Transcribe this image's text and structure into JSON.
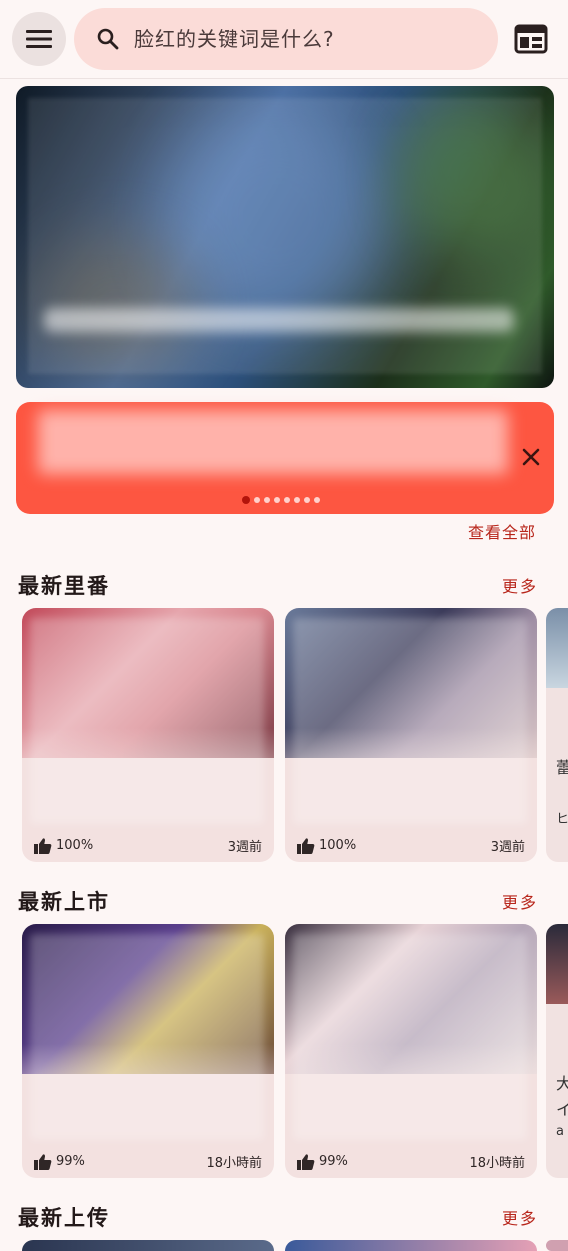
{
  "search": {
    "placeholder": "脸红的关键词是什么?"
  },
  "banner": {
    "dots_total": 8,
    "active_dot": 0
  },
  "see_all_label": "查看全部",
  "sections": [
    {
      "title": "最新里番",
      "more": "更多",
      "cards": [
        {
          "likes": "100%",
          "time": "3週前"
        },
        {
          "likes": "100%",
          "time": "3週前"
        }
      ],
      "peek_glyphs": [
        "蕾",
        "ヒ"
      ]
    },
    {
      "title": "最新上市",
      "more": "更多",
      "cards": [
        {
          "likes": "99%",
          "time": "18小時前"
        },
        {
          "likes": "99%",
          "time": "18小時前"
        }
      ],
      "peek_glyphs": [
        "大",
        "イ",
        "a"
      ]
    },
    {
      "title": "最新上传",
      "more": "更多"
    }
  ],
  "colors": {
    "accent": "#fd5641",
    "link": "#b8261b",
    "search_bg": "#fbdcd8",
    "card_bg": "#f3e1e0",
    "background": "#fdf6f5"
  },
  "icons": {
    "menu": "hamburger-menu-icon",
    "search": "search-icon",
    "calendar": "calendar-view-icon",
    "close": "close-icon",
    "like": "thumbs-up-icon"
  }
}
